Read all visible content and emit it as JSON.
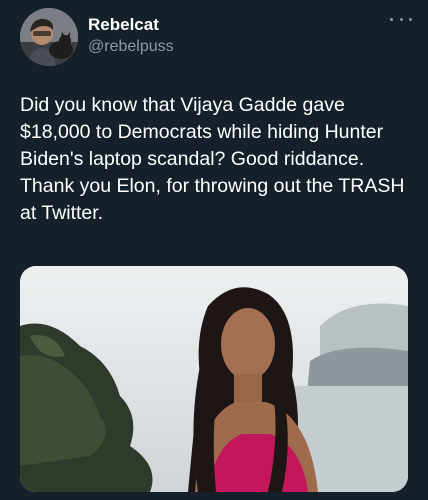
{
  "tweet": {
    "author": {
      "display_name": "Rebelcat",
      "handle": "@rebelpuss",
      "avatar_icon": "profile-photo"
    },
    "more_icon": "ellipsis-icon",
    "text": "Did you know that Vijaya Gadde gave $18,000 to Democrats while hiding Hunter Biden's laptop scandal? Good riddance. Thank you Elon, for throwing out the TRASH at Twitter.",
    "media": {
      "type": "photo"
    }
  },
  "colors": {
    "background": "#15202b",
    "primary_text": "#ffffff",
    "secondary_text": "#8b98a5"
  }
}
